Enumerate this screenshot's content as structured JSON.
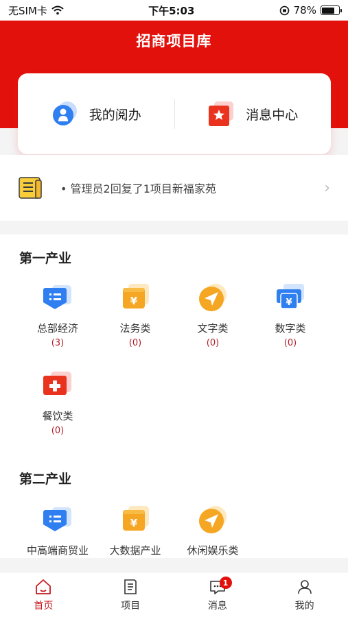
{
  "status_bar": {
    "carrier": "无SIM卡",
    "time": "下午5:03",
    "battery": "78%",
    "battery_level": 0.78
  },
  "header": {
    "title": "招商项目库"
  },
  "quick_actions": [
    {
      "label": "我的阅办",
      "icon": "document-person-icon"
    },
    {
      "label": "消息中心",
      "icon": "star-message-icon"
    }
  ],
  "notice": {
    "text": "• 管理员2回复了1项目新福家苑"
  },
  "sections": [
    {
      "title": "第一产业",
      "items": [
        {
          "label": "总部经济",
          "count": "(3)",
          "icon": "list-icon"
        },
        {
          "label": "法务类",
          "count": "(0)",
          "icon": "yen-wallet-icon"
        },
        {
          "label": "文字类",
          "count": "(0)",
          "icon": "send-icon"
        },
        {
          "label": "数字类",
          "count": "(0)",
          "icon": "yen-card-icon"
        },
        {
          "label": "餐饮类",
          "count": "(0)",
          "icon": "plus-icon"
        }
      ]
    },
    {
      "title": "第二产业",
      "items": [
        {
          "label": "中高端商贸业",
          "icon": "list-icon"
        },
        {
          "label": "大数据产业",
          "icon": "yen-wallet-icon"
        },
        {
          "label": "休闲娱乐类",
          "icon": "send-icon"
        }
      ]
    }
  ],
  "tabbar": [
    {
      "label": "首页",
      "icon": "home-icon",
      "active": true
    },
    {
      "label": "项目",
      "icon": "document-icon"
    },
    {
      "label": "消息",
      "icon": "message-icon",
      "badge": "1"
    },
    {
      "label": "我的",
      "icon": "user-icon"
    }
  ],
  "colors": {
    "brand": "#e3110c",
    "count": "#b1202b",
    "blue": "#2f7ff0",
    "orange": "#f5a623"
  }
}
